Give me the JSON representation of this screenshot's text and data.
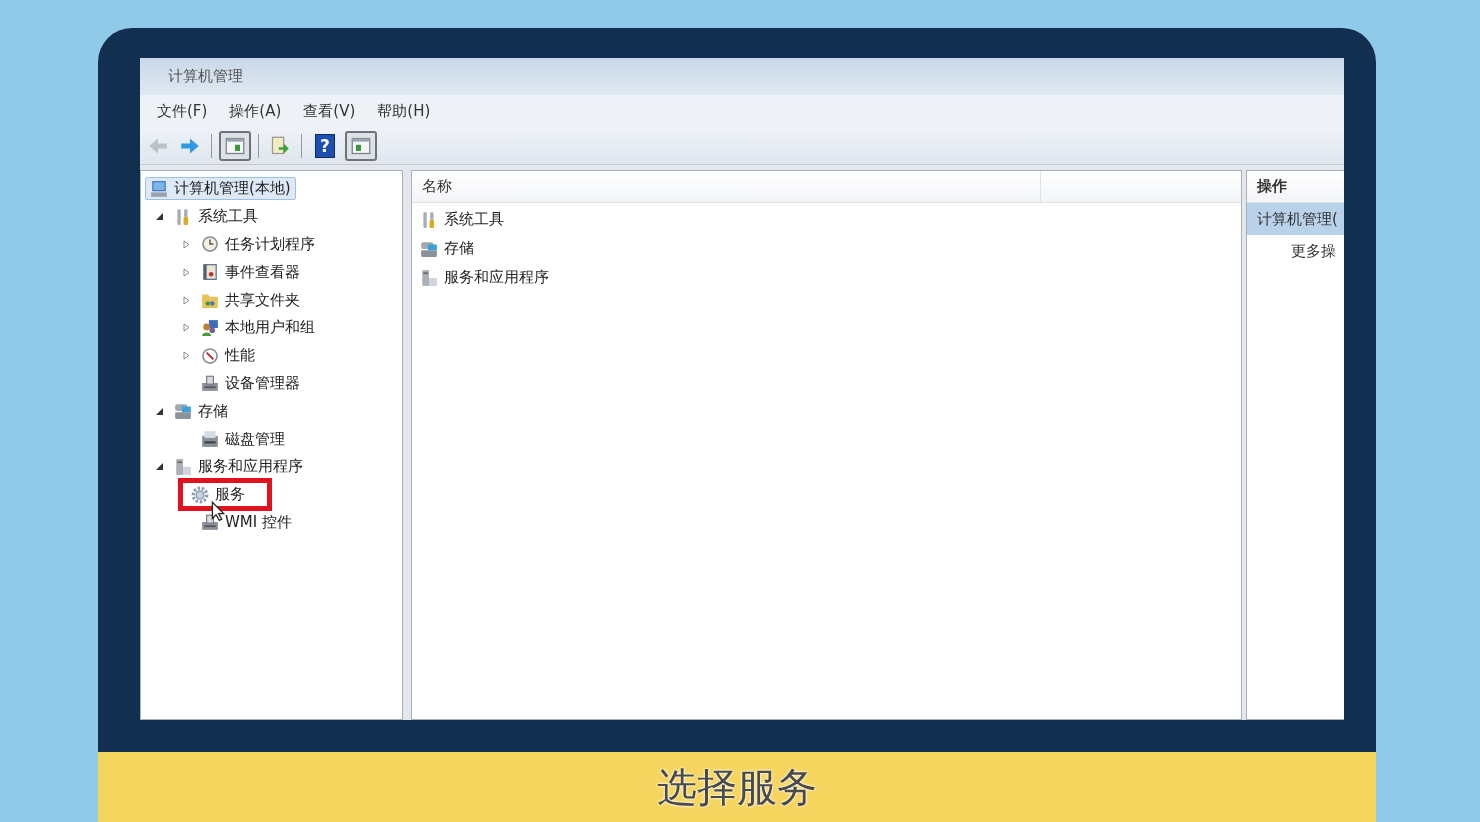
{
  "window": {
    "title": "计算机管理"
  },
  "menu": [
    "文件(F)",
    "操作(A)",
    "查看(V)",
    "帮助(H)"
  ],
  "toolbar": [
    {
      "kind": "back",
      "disabled": true
    },
    {
      "kind": "forward",
      "disabled": false
    },
    {
      "kind": "separator"
    },
    {
      "kind": "pane"
    },
    {
      "kind": "separator"
    },
    {
      "kind": "export"
    },
    {
      "kind": "separator"
    },
    {
      "kind": "help",
      "glyph": "?"
    },
    {
      "kind": "pane2"
    }
  ],
  "tree": [
    {
      "label": "计算机管理(本地)",
      "kind": "computer",
      "selected": true,
      "marked": false,
      "children": [
        {
          "label": "系统工具",
          "kind": "tools",
          "expanded": true,
          "selected": false,
          "marked": false,
          "children": [
            {
              "label": "任务计划程序",
              "kind": "clock",
              "expanded": false,
              "selected": false,
              "marked": false
            },
            {
              "label": "事件查看器",
              "kind": "log",
              "expanded": false,
              "selected": false,
              "marked": false
            },
            {
              "label": "共享文件夹",
              "kind": "folder",
              "expanded": false,
              "selected": false,
              "marked": false
            },
            {
              "label": "本地用户和组",
              "kind": "users",
              "expanded": false,
              "selected": false,
              "marked": false
            },
            {
              "label": "性能",
              "kind": "gauge",
              "expanded": false,
              "selected": false,
              "marked": false
            },
            {
              "label": "设备管理器",
              "kind": "device",
              "selected": false,
              "marked": false
            }
          ]
        },
        {
          "label": "存储",
          "kind": "storage",
          "expanded": true,
          "selected": false,
          "marked": false,
          "children": [
            {
              "label": "磁盘管理",
              "kind": "disk",
              "selected": false,
              "marked": false
            }
          ]
        },
        {
          "label": "服务和应用程序",
          "kind": "server",
          "expanded": true,
          "selected": false,
          "marked": false,
          "children": [
            {
              "label": "服务",
              "kind": "gear",
              "selected": false,
              "marked": true
            },
            {
              "label": "WMI 控件",
              "kind": "device",
              "selected": false,
              "marked": false
            }
          ]
        }
      ]
    }
  ],
  "list": {
    "columns": [
      "名称"
    ],
    "rows": [
      {
        "label": "系统工具",
        "kind": "tools"
      },
      {
        "label": "存储",
        "kind": "storage"
      },
      {
        "label": "服务和应用程序",
        "kind": "server"
      }
    ]
  },
  "actions": {
    "header": "操作",
    "items": [
      {
        "label": "计算机管理(",
        "selected": true
      },
      {
        "label": "更多操",
        "selected": false
      }
    ]
  },
  "caption": "选择服务"
}
